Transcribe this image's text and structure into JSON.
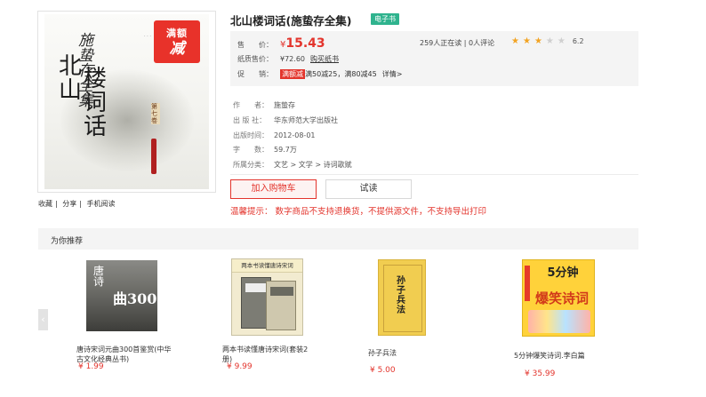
{
  "product": {
    "cover": {
      "badge_line1": "满额",
      "badge_line2": "减",
      "cover_author": "施蛰存全集",
      "cover_title_a": "北山",
      "cover_title_b": "楼词话",
      "cover_volume": "第七卷"
    },
    "share_links": [
      "收藏",
      "分享",
      "手机阅读"
    ],
    "title": "北山楼词话(施蛰存全集)",
    "ebook_tag": "电子书",
    "price": {
      "label": "售　　价：",
      "currency": "¥",
      "value": "15.43",
      "paper_label": "纸质售价：",
      "paper_value": "¥72.60",
      "paper_link": "购买纸书",
      "promo_label": "促　　销：",
      "promo_tag": "满额减",
      "promo_text": "满50减25，满80减45",
      "promo_link": "详情>"
    },
    "stats": "259人正在读 | 0人评论",
    "rating": {
      "stars_on": 3,
      "stars_total": 5,
      "score": "6.2"
    },
    "meta": [
      {
        "label": "作　　者：",
        "value": "施蛰存"
      },
      {
        "label": "出  版  社：",
        "value": "华东师范大学出版社"
      },
      {
        "label": "出版时间：",
        "value": "2012-08-01"
      },
      {
        "label": "字　　数：",
        "value": "59.7万"
      },
      {
        "label": "所属分类：",
        "value": "文艺 > 文学 > 诗词歌赋"
      }
    ],
    "buttons": {
      "cart": "加入购物车",
      "try": "试读"
    },
    "warning": "温馨提示：  数字商品不支持退换货，不提供源文件，不支持导出打印"
  },
  "recommend": {
    "header": "为你推荐",
    "arrow": "‹",
    "books": [
      {
        "name": "唐诗宋词元曲300首鉴赏(中华古文化经典丛书)",
        "price": "¥ 1.99",
        "cover_text": "唐诗宋词元曲300"
      },
      {
        "name": "两本书读懂唐诗宋词(套装2册)",
        "price": "¥ 9.99",
        "cover_text": "两本书读懂唐诗宋词"
      },
      {
        "name": "孙子兵法",
        "price": "¥ 5.00",
        "cover_text": "孙子兵法"
      },
      {
        "name": "5分钟爆笑诗词.李白篇",
        "price": "¥ 35.99",
        "cover_text_a": "5分钟",
        "cover_text_b": "爆笑诗词"
      }
    ]
  },
  "colors": {
    "accent": "#e3342c",
    "tag": "#2fb38e",
    "star": "#f2a322"
  }
}
